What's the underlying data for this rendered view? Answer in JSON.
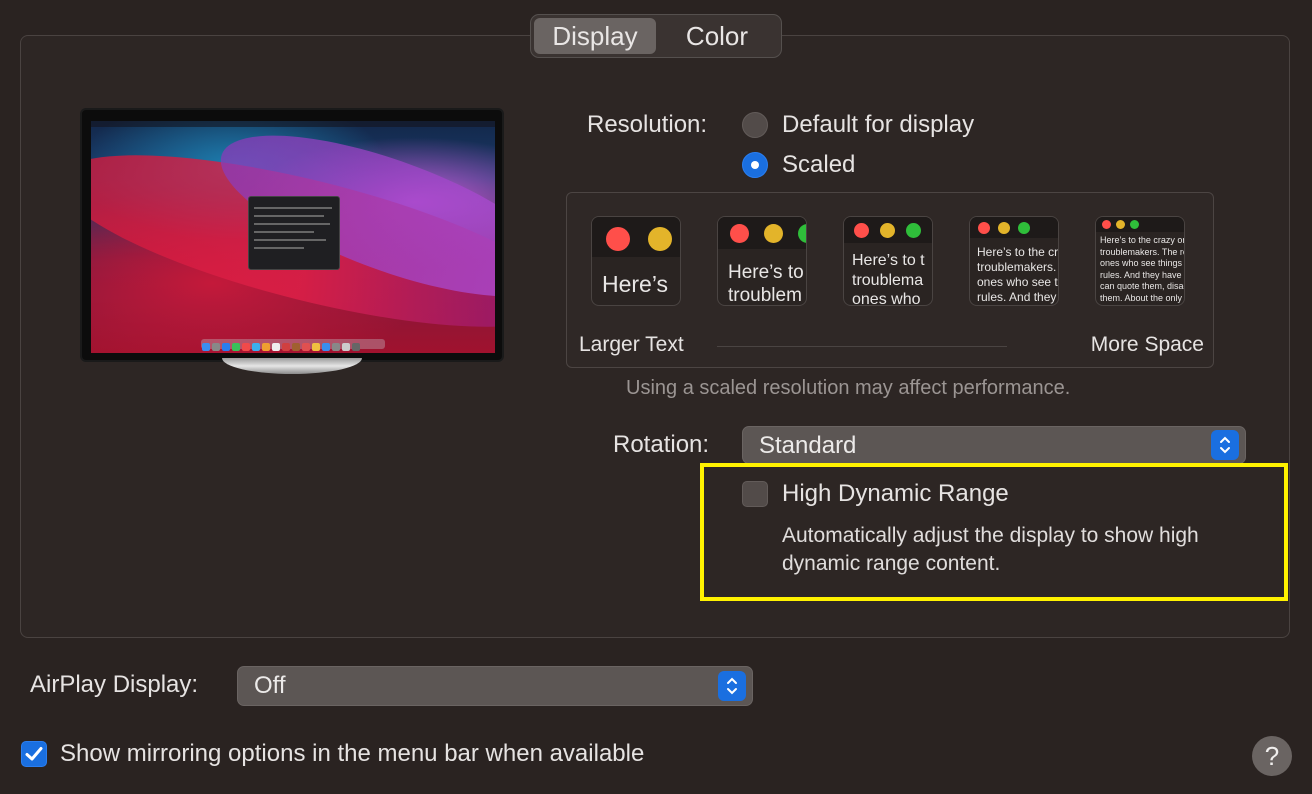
{
  "tabs": [
    {
      "label": "Display",
      "active": true
    },
    {
      "label": "Color",
      "active": false
    }
  ],
  "resolution": {
    "label": "Resolution:",
    "options": [
      {
        "label": "Default for display",
        "selected": false
      },
      {
        "label": "Scaled",
        "selected": true
      }
    ]
  },
  "scaling": {
    "thumbs": [
      {
        "text": "Here’s"
      },
      {
        "text": "Here’s to\ntroublem"
      },
      {
        "text": "Here’s to t\ntroublema\nones who"
      },
      {
        "text": "Here’s to the cr\ntroublemakers.\nones who see t\nrules. And they"
      },
      {
        "text": "Here’s to the crazy one\ntroublemakers. The rou\nones who see things dif\nrules. And they have no\ncan quote them, disagr\nthem. About the only th\nBecause they change th"
      }
    ],
    "left_label": "Larger Text",
    "right_label": "More Space",
    "note": "Using a scaled resolution may affect performance."
  },
  "rotation": {
    "label": "Rotation:",
    "value": "Standard"
  },
  "hdr": {
    "label": "High Dynamic Range",
    "checked": false,
    "description": "Automatically adjust the display to show high dynamic range content."
  },
  "airplay": {
    "label": "AirPlay Display:",
    "value": "Off"
  },
  "mirroring": {
    "label": "Show mirroring options in the menu bar when available",
    "checked": true
  },
  "help": {
    "label": "?"
  },
  "colors": {
    "accent": "#1a6fe0",
    "highlight": "#fff200",
    "traffic_red": "#ff4f4a",
    "traffic_yellow": "#e3b42a",
    "traffic_green": "#2fbe3a"
  }
}
